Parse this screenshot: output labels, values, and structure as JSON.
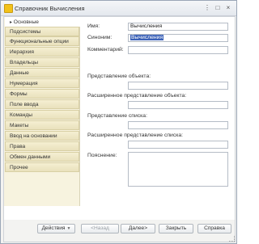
{
  "window": {
    "title": "Справочник Вычисления",
    "controls": [
      "⋮",
      "□",
      "×"
    ]
  },
  "sidebar": {
    "items": [
      {
        "label": "Основные",
        "active": true
      },
      {
        "label": "Подсистемы"
      },
      {
        "label": "Функциональные опции"
      },
      {
        "label": "Иерархия"
      },
      {
        "label": "Владельцы"
      },
      {
        "label": "Данные"
      },
      {
        "label": "Нумерация"
      },
      {
        "label": "Формы"
      },
      {
        "label": "Поле ввода"
      },
      {
        "label": "Команды"
      },
      {
        "label": "Макеты"
      },
      {
        "label": "Ввод на основании"
      },
      {
        "label": "Права"
      },
      {
        "label": "Обмен данными"
      },
      {
        "label": "Прочее"
      }
    ]
  },
  "form": {
    "name_label": "Имя:",
    "name_value": "Вычисления",
    "synonym_label": "Синоним:",
    "synonym_value": "Вычисления",
    "comment_label": "Комментарий:",
    "comment_value": "",
    "object_repr_label": "Представление объекта:",
    "object_repr_value": "",
    "ext_object_repr_label": "Расширенное представление объекта:",
    "ext_object_repr_value": "",
    "list_repr_label": "Представление списка:",
    "list_repr_value": "",
    "ext_list_repr_label": "Расширенное представление списка:",
    "ext_list_repr_value": "",
    "explanation_label": "Пояснение:",
    "explanation_value": ""
  },
  "buttons": {
    "actions": "Действия",
    "back": "<Назад",
    "next": "Далее>",
    "close": "Закрыть",
    "help": "Справка"
  }
}
